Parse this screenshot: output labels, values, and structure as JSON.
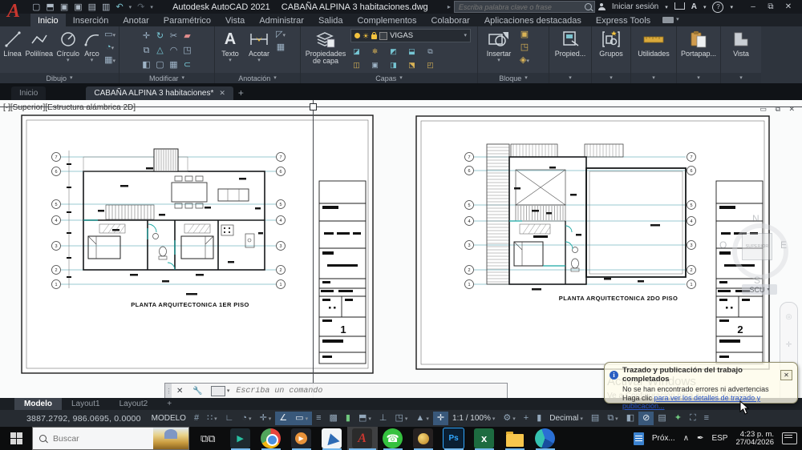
{
  "titlebar": {
    "app_title": "Autodesk AutoCAD 2021",
    "doc_title": "CABAÑA ALPINA 3 habitaciones.dwg",
    "search_placeholder": "Escriba palabra clave o frase",
    "sign_in_label": "Iniciar sesión"
  },
  "icons": {
    "caret_down": "▾",
    "caret_right": "▸",
    "close": "✕",
    "minimize": "–",
    "restore": "⧉",
    "undo": "↶",
    "redo": "↷",
    "question": "?",
    "plus": "+",
    "menu": "≡",
    "chevron_up": "∧",
    "new_file": "▢",
    "open_file": "⬒",
    "save": "▣",
    "save_as": "▣",
    "plot": "▤",
    "publish": "▥",
    "print": "▤",
    "move": "✛",
    "rotate": "↻",
    "trim": "✂",
    "erase": "▰",
    "copy": "⧉",
    "mirror": "△",
    "fillet": "◠",
    "explode": "◳",
    "stretch": "◧",
    "scale": "▢",
    "array": "▦",
    "offset": "⊂",
    "grid": "#",
    "snap": "∷",
    "ortho": "∟",
    "polar": "∠",
    "dynamic_input": "▭",
    "lineweight": "≡",
    "hatch_toggle": "▩",
    "osnap": "▮",
    "cube": "⬒",
    "ucs": "⊥",
    "annotation": "▲",
    "gear": "⚙",
    "crosshair": "✛",
    "units_icon": "▮",
    "list": "▤",
    "monitor": "⧉",
    "graphics": "◔",
    "isolate": "⊘",
    "plotter": "▤",
    "clean": "✦",
    "fullscreen": "⛶",
    "ink": "✒",
    "text_tool": "A",
    "dim_tool": "⊢⊣",
    "phone": "☎"
  },
  "ribbon_tabs": [
    "Inicio",
    "Inserción",
    "Anotar",
    "Paramétrico",
    "Vista",
    "Administrar",
    "Salida",
    "Complementos",
    "Colaborar",
    "Aplicaciones destacadas",
    "Express Tools"
  ],
  "panels": {
    "dibujo": {
      "label": "Dibujo",
      "linea": "Línea",
      "polilinea": "Polilínea",
      "circulo": "Círculo",
      "arco": "Arco"
    },
    "modificar": {
      "label": "Modificar"
    },
    "anotacion": {
      "label": "Anotación",
      "texto": "Texto",
      "acotar": "Acotar"
    },
    "capas": {
      "label": "Capas",
      "propiedades": "Propiedades de capa",
      "layer_value": "VIGAS"
    },
    "bloque": {
      "label": "Bloque",
      "insertar": "Insertar"
    },
    "propiedades": {
      "label": "Propied..."
    },
    "grupos": {
      "label": "Grupos"
    },
    "utilidades": {
      "label": "Utilidades"
    },
    "portapapeles": {
      "label": "Portapap..."
    },
    "vista": {
      "label": "Vista"
    }
  },
  "file_tabs": {
    "inicio": "Inicio",
    "documento": "CABAÑA ALPINA 3 habitaciones*",
    "new_tab": "+"
  },
  "viewport": {
    "label": "[-][Superior][Estructura alámbrica 2D]",
    "viewcube_face": "SUPERIOR",
    "compass_n": "N",
    "compass_s": "S",
    "compass_e": "E",
    "compass_o": "O",
    "ucs_label": "SCU"
  },
  "sheets": {
    "grid_labels": [
      "7",
      "6",
      "5",
      "4",
      "3",
      "2",
      "1"
    ],
    "sheet1": {
      "title": "PLANTA ARQUITECTONICA 1ER PISO",
      "sheet_number": "1"
    },
    "sheet2": {
      "title": "PLANTA ARQUITECTONICA 2DO PISO",
      "sheet_number": "2"
    }
  },
  "command_line": {
    "placeholder": "Escriba un comando"
  },
  "layout_tabs": {
    "modelo": "Modelo",
    "layout1": "Layout1",
    "layout2": "Layout2",
    "new_layout": "+"
  },
  "status_bar": {
    "coordinates": "3887.2792, 986.0695, 0.0000",
    "model_label": "MODELO",
    "annotation_scale": "1:1 / 100%",
    "units": "Decimal"
  },
  "notification": {
    "title": "Trazado y publicación del trabajo completados",
    "body": "No se han encontrado errores ni advertencias",
    "link_prefix": "Haga clic ",
    "link_text": "para ver los detalles de trazado y publicación..."
  },
  "watermark": {
    "line1": "Activar Windows",
    "line2": "Ve a Configuración para activar Windows."
  },
  "taskbar": {
    "search_placeholder": "Buscar",
    "tray_item": "Próx...",
    "language": "ESP",
    "time": "4:23 p. m.",
    "date": "27/04/2026"
  }
}
